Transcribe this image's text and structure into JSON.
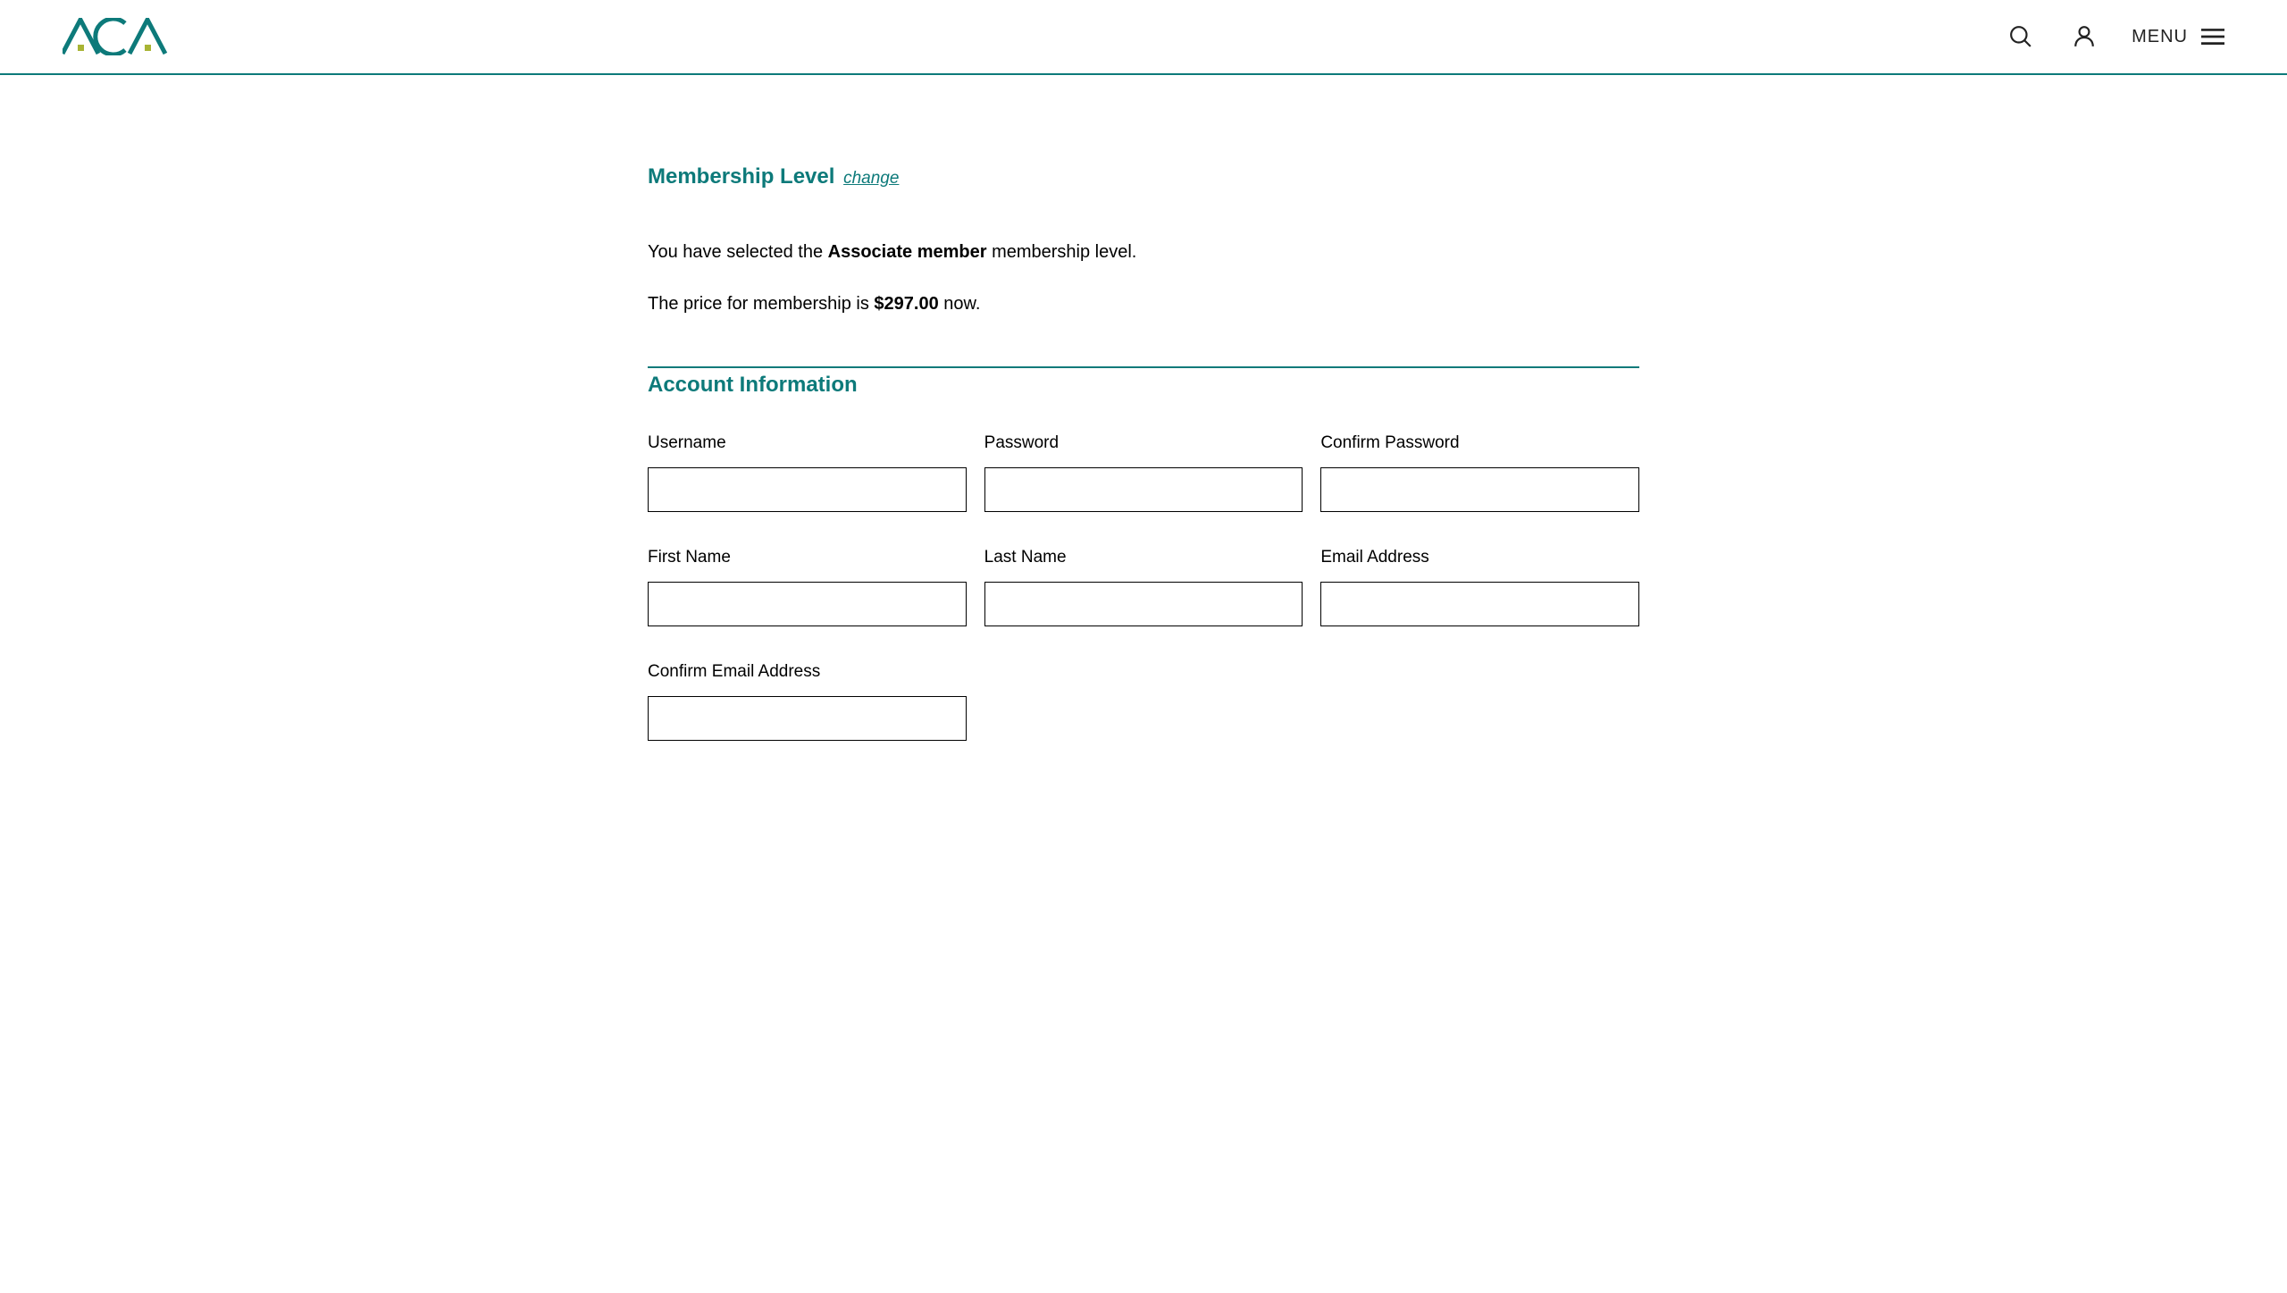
{
  "header": {
    "logo_text": "ACA",
    "menu_label": "MENU"
  },
  "membership": {
    "heading": "Membership Level",
    "change_link": "change",
    "selected_prefix": "You have selected the ",
    "selected_level": "Associate member",
    "selected_suffix": " membership level.",
    "price_prefix": "The price for membership is ",
    "price": "$297.00",
    "price_suffix": " now."
  },
  "account": {
    "heading": "Account Information",
    "fields": {
      "username": {
        "label": "Username",
        "value": ""
      },
      "password": {
        "label": "Password",
        "value": ""
      },
      "confirm_password": {
        "label": "Confirm Password",
        "value": ""
      },
      "first_name": {
        "label": "First Name",
        "value": ""
      },
      "last_name": {
        "label": "Last Name",
        "value": ""
      },
      "email": {
        "label": "Email Address",
        "value": ""
      },
      "confirm_email": {
        "label": "Confirm Email Address",
        "value": ""
      }
    }
  }
}
